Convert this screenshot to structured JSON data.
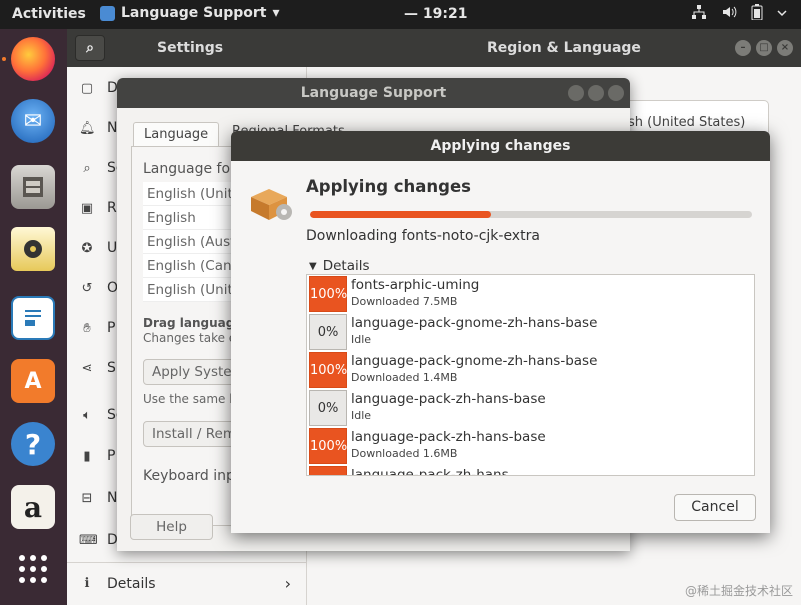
{
  "topbar": {
    "activities": "Activities",
    "app_name": "Language Support",
    "app_menu_arrow": "▾",
    "clock": "— 19:21",
    "tray_icons": [
      "network-icon",
      "volume-icon",
      "battery-icon",
      "system-menu-icon"
    ]
  },
  "dock": {
    "items": [
      "Firefox",
      "Thunderbird",
      "Files",
      "Rhythmbox",
      "LibreOffice Writer",
      "Ubuntu Software",
      "Help",
      "Amazon",
      "Show Applications"
    ]
  },
  "settings": {
    "title_left": "Settings",
    "title_right": "Region & Language",
    "search_icon": "⌕",
    "sidebar": [
      {
        "label": "D",
        "icon": "display-icon"
      },
      {
        "label": "N",
        "icon": "notifications-icon"
      },
      {
        "label": "Se",
        "icon": "search-icon"
      },
      {
        "label": "R",
        "icon": "region-icon"
      },
      {
        "label": "U",
        "icon": "universal-access-icon"
      },
      {
        "label": "O",
        "icon": "online-accounts-icon"
      },
      {
        "label": "P",
        "icon": "privacy-icon"
      },
      {
        "label": "Sh",
        "icon": "sharing-icon"
      },
      {
        "label": "So",
        "icon": "sound-icon"
      },
      {
        "label": "P",
        "icon": "power-icon"
      },
      {
        "label": "N",
        "icon": "network-icon"
      },
      {
        "label": "D",
        "icon": "devices-icon"
      }
    ],
    "details_label": "Details",
    "region_value": "sh (United States)"
  },
  "lang_support": {
    "title": "Language Support",
    "tab_language": "Language",
    "tab_regional": "Regional Formats",
    "language_for_label": "Language for",
    "languages": [
      "English (Unite",
      "English",
      "English (Aust",
      "English (Cana",
      "English (Unite"
    ],
    "drag_label": "Drag languages",
    "changes_take_label": "Changes take ef",
    "apply_system_button": "Apply Syster",
    "use_same_text": "Use the same lan",
    "install_remove_button": "Install / Rem",
    "keyboard_input_label": "Keyboard inp",
    "help_button": "Help"
  },
  "dialog": {
    "title": "Applying changes",
    "heading": "Applying changes",
    "progress_fraction": 0.41,
    "status": "Downloading fonts-noto-cjk-extra",
    "details_label": "Details",
    "details_arrow": "▼",
    "packages": [
      {
        "pct": "100%",
        "name": "fonts-arphic-uming",
        "sub": "Downloaded 7.5MB",
        "done": true
      },
      {
        "pct": "0%",
        "name": "language-pack-gnome-zh-hans-base",
        "sub": "Idle",
        "done": false
      },
      {
        "pct": "100%",
        "name": "language-pack-gnome-zh-hans-base",
        "sub": "Downloaded 1.4MB",
        "done": true
      },
      {
        "pct": "0%",
        "name": "language-pack-zh-hans-base",
        "sub": "Idle",
        "done": false
      },
      {
        "pct": "100%",
        "name": "language-pack-zh-hans-base",
        "sub": "Downloaded 1.6MB",
        "done": true
      },
      {
        "pct": "",
        "name": "language-pack-zh-hans",
        "sub": "",
        "done": true
      }
    ],
    "cancel_button": "Cancel"
  },
  "watermark": "@稀土掘金技术社区",
  "colors": {
    "accent": "#e95420",
    "topbar": "#1d1d1d",
    "titlebar": "#3c3b37"
  }
}
